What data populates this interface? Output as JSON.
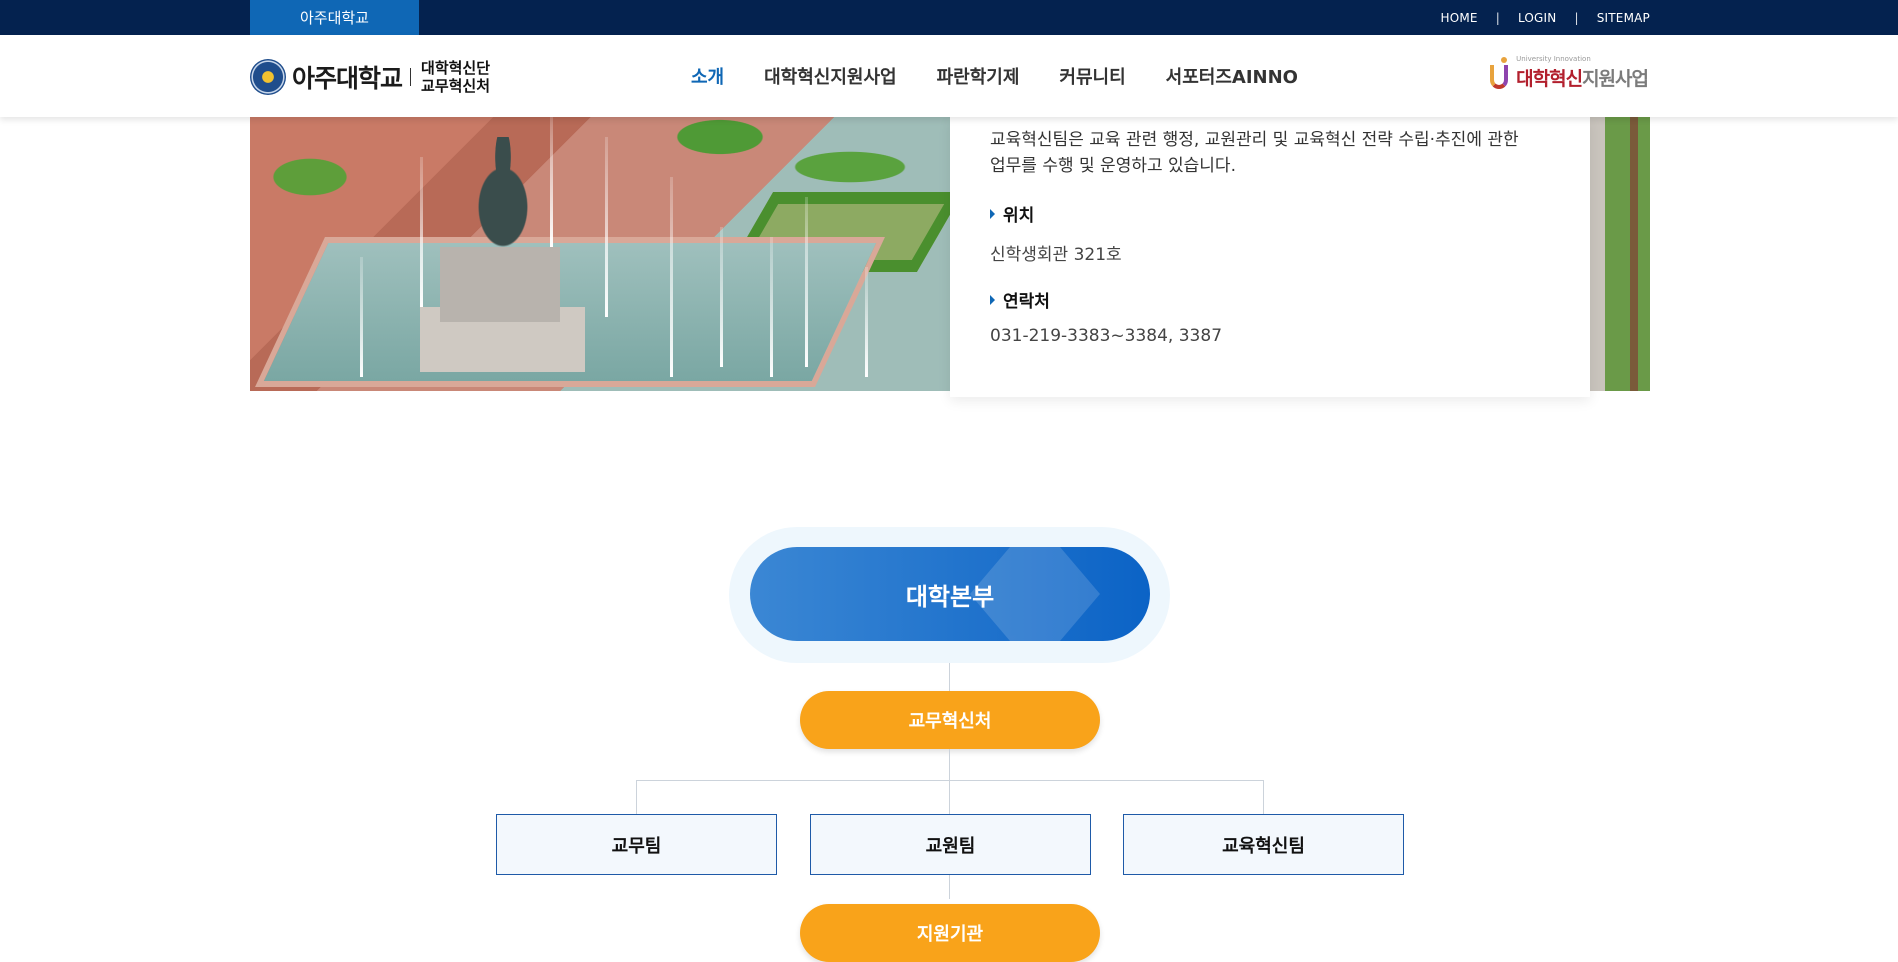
{
  "topbar": {
    "university_tab": "아주대학교",
    "util_links": [
      "HOME",
      "LOGIN",
      "SITEMAP"
    ],
    "separator": "|"
  },
  "header": {
    "logo_wordmark": "아주대학교",
    "logo_sub_line1": "대학혁신단",
    "logo_sub_line2": "교무혁신처",
    "nav": [
      "소개",
      "대학혁신지원사업",
      "파란학기제",
      "커뮤니티",
      "서포터즈AINNO"
    ],
    "active_nav": "소개",
    "program_logo": {
      "tagline": "University Innovation",
      "red_text": "대학혁신",
      "gray_text": "지원사업"
    }
  },
  "info_card": {
    "description": "교육혁신팀은 교육 관련 행정, 교원관리 및 교육혁신 전략 수립·추진에 관한 업무를 수행 및 운영하고 있습니다.",
    "location_label": "위치",
    "location_value": "신학생회관 321호",
    "contact_label": "연락처",
    "contact_value": "031-219-3383~3384, 3387"
  },
  "org_chart": {
    "top": "대학본부",
    "division": "교무혁신처",
    "teams": [
      "교무팀",
      "교원팀",
      "교육혁신팀"
    ],
    "support": "지원기관"
  },
  "colors": {
    "topbar_bg": "#04224f",
    "accent_blue": "#0f67b5",
    "orange": "#f9a31a",
    "team_border": "#1e5aa8"
  }
}
